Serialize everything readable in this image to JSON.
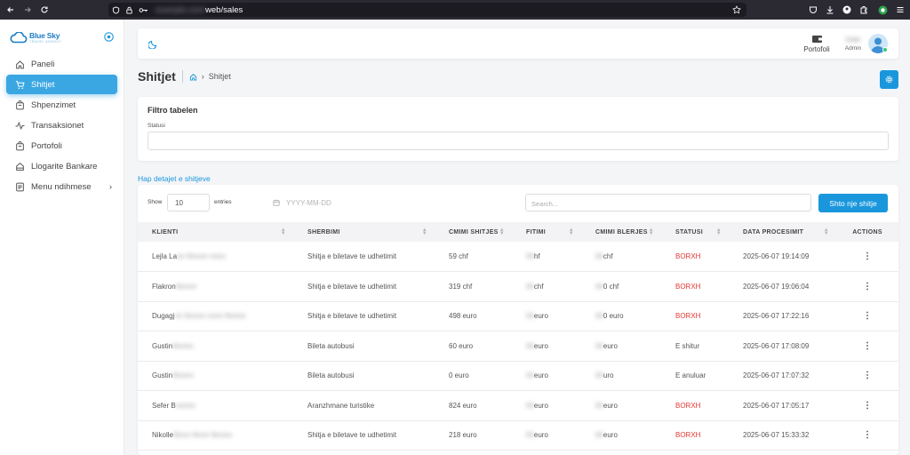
{
  "browser": {
    "url_path": "web/sales",
    "url_host": "example.com/"
  },
  "brand": {
    "name": "Blue Sky",
    "tagline": "TRAVEL AGENCY"
  },
  "sidebar": {
    "items": [
      {
        "label": "Paneli",
        "icon": "home-icon"
      },
      {
        "label": "Shitjet",
        "icon": "cart-icon",
        "active": true
      },
      {
        "label": "Shpenzimet",
        "icon": "bag-icon"
      },
      {
        "label": "Transaksionet",
        "icon": "activity-icon"
      },
      {
        "label": "Portofoli",
        "icon": "bag-icon"
      },
      {
        "label": "Llogarite Bankare",
        "icon": "bank-icon"
      },
      {
        "label": "Menu ndihmese",
        "icon": "document-icon",
        "chevron": "›"
      }
    ]
  },
  "topbar": {
    "portfolio_label": "Portofoli",
    "user_name": "User",
    "user_role": "Admin"
  },
  "page": {
    "title": "Shitjet",
    "breadcrumb": "Shitjet"
  },
  "filter": {
    "title": "Filtro tabelen",
    "status_label": "Statusi"
  },
  "details_link": "Hap detajet e shitjeve",
  "table_controls": {
    "show_label": "Show",
    "entries_value": "10",
    "entries_label": "entries",
    "date_placeholder": "YYYY-MM-DD",
    "search_placeholder": "Search...",
    "add_button": "Shto nje shitje"
  },
  "columns": [
    "KLIENTI",
    "SHERBIMI",
    "CMIMI SHITJES",
    "FITIMI",
    "CMIMI BLERJES",
    "STATUSI",
    "DATA PROCESIMIT",
    "ACTIONS"
  ],
  "rows": [
    {
      "client": "Lejla La",
      "client_hidden": "nn Nnnnn nnnn",
      "service": "Shitja e biletave te udhetimit",
      "price": "59 chf",
      "profit_hidden": "00",
      "profit": "hf",
      "cost_hidden": "00",
      "cost": "chf",
      "status": "BORXH",
      "date": "2025-06-07 19:14:09"
    },
    {
      "client": "Flakron",
      "client_hidden": "Nnnnn",
      "service": "Shitja e biletave te udhetimit",
      "price": "319 chf",
      "profit_hidden": "00",
      "profit": "chf",
      "cost_hidden": "00",
      "cost": "0 chf",
      "status": "BORXH",
      "date": "2025-06-07 19:06:04"
    },
    {
      "client": "Dugagj",
      "client_hidden": "nn Nnnnn nnnn Nnnnn",
      "service": "Shitja e biletave te udhetimit",
      "price": "498 euro",
      "profit_hidden": "00",
      "profit": "euro",
      "cost_hidden": "00",
      "cost": "0 euro",
      "status": "BORXH",
      "date": "2025-06-07 17:22:16"
    },
    {
      "client": "Gustin",
      "client_hidden": "Nnnnn",
      "service": "Bileta autobusi",
      "price": "60 euro",
      "profit_hidden": "00",
      "profit": "euro",
      "cost_hidden": "00",
      "cost": "euro",
      "status": "E shitur",
      "date": "2025-06-07 17:08:09"
    },
    {
      "client": "Gustin",
      "client_hidden": "Nnnnn",
      "service": "Bileta autobusi",
      "price": "0 euro",
      "profit_hidden": "00",
      "profit": "euro",
      "cost_hidden": "00",
      "cost": "uro",
      "status": "E anuluar",
      "date": "2025-06-07 17:07:32"
    },
    {
      "client": "Sefer B",
      "client_hidden": "nnnnn",
      "service": "Aranzhmane turistike",
      "price": "824 euro",
      "profit_hidden": "00",
      "profit": "euro",
      "cost_hidden": "00",
      "cost": "euro",
      "status": "BORXH",
      "date": "2025-06-07 17:05:17"
    },
    {
      "client": "Nikolle",
      "client_hidden": "Nnnn Nnnn Nnnnn",
      "service": "Shitja e biletave te udhetimit",
      "price": "218 euro",
      "profit_hidden": "00",
      "profit": "euro",
      "cost_hidden": "00",
      "cost": "euro",
      "status": "BORXH",
      "date": "2025-06-07 15:33:32"
    }
  ],
  "colors": {
    "accent": "#1a97dc",
    "active_nav": "#3aa7e3",
    "debt": "#e53935"
  }
}
